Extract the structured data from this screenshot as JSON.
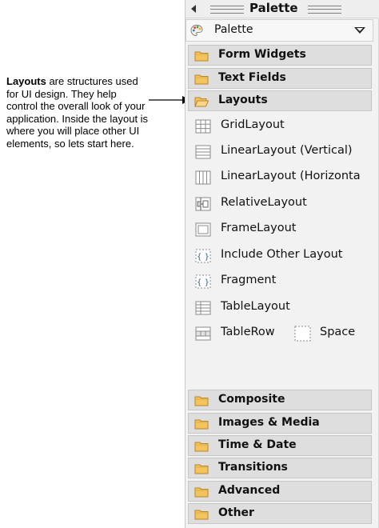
{
  "annotation": {
    "bold": "Layouts",
    "text": " are structures used for UI design. They help control the overall look of your application. Inside the layout is where you will place other UI elements, so lets start here."
  },
  "palette": {
    "title": "Palette",
    "dropdown_value": "Palette",
    "drawers_top": [
      {
        "label": "Form Widgets",
        "icon": "folder-closed-icon"
      },
      {
        "label": "Text Fields",
        "icon": "folder-closed-icon"
      },
      {
        "label": "Layouts",
        "icon": "folder-open-icon"
      }
    ],
    "layout_items": [
      {
        "label": "GridLayout",
        "icon": "grid-layout-icon"
      },
      {
        "label": "LinearLayout (Vertical)",
        "icon": "linear-vertical-icon"
      },
      {
        "label": "LinearLayout (Horizonta",
        "icon": "linear-horizontal-icon"
      },
      {
        "label": "RelativeLayout",
        "icon": "relative-layout-icon"
      },
      {
        "label": "FrameLayout",
        "icon": "frame-layout-icon"
      },
      {
        "label": "Include Other Layout",
        "icon": "include-layout-icon"
      },
      {
        "label": "Fragment",
        "icon": "fragment-icon"
      },
      {
        "label": "TableLayout",
        "icon": "table-layout-icon"
      },
      {
        "label": "TableRow",
        "icon": "table-row-icon"
      }
    ],
    "space_item": {
      "label": "Space",
      "icon": "space-icon"
    },
    "drawers_bottom": [
      {
        "label": "Composite",
        "icon": "folder-closed-icon"
      },
      {
        "label": "Images & Media",
        "icon": "folder-closed-icon"
      },
      {
        "label": "Time & Date",
        "icon": "folder-closed-icon"
      },
      {
        "label": "Transitions",
        "icon": "folder-closed-icon"
      },
      {
        "label": "Advanced",
        "icon": "folder-closed-icon"
      },
      {
        "label": "Other",
        "icon": "folder-closed-icon"
      }
    ]
  },
  "colors": {
    "folder_fill": "#f3c35e",
    "folder_stroke": "#b8872a",
    "icon_stroke": "#8a8a8a",
    "drawer_bg": "#dedede",
    "panel_bg": "#f2f2f2"
  }
}
